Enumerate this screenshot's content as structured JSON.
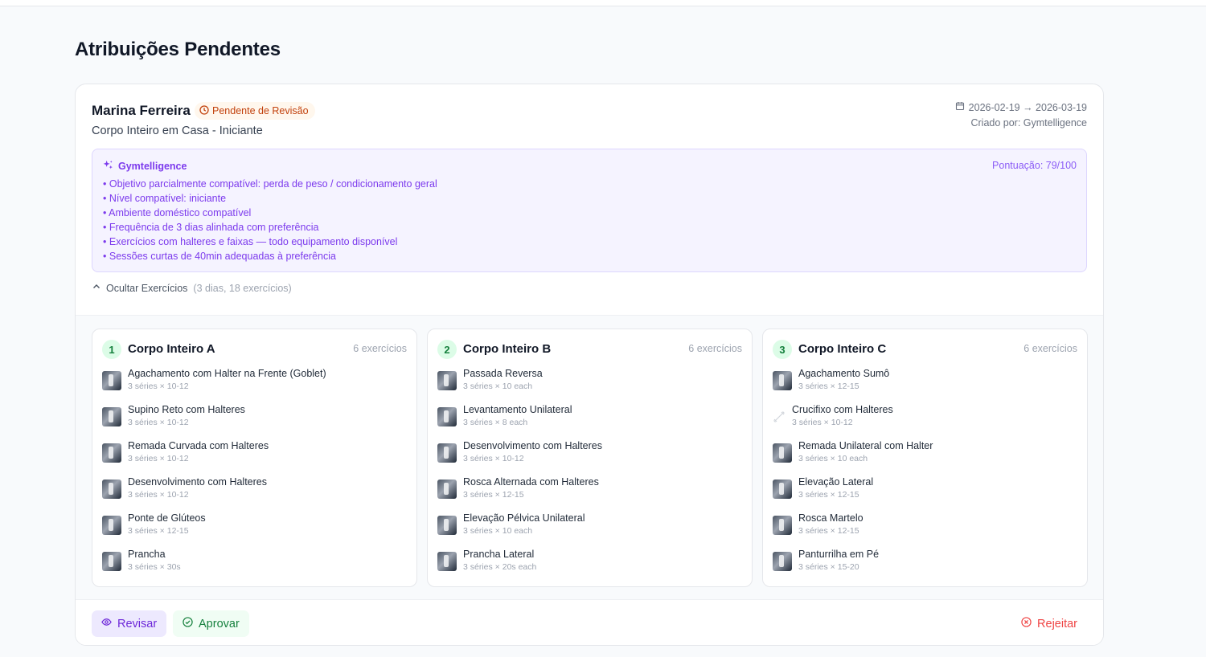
{
  "page": {
    "title": "Atribuições Pendentes"
  },
  "assignment": {
    "client_name": "Marina Ferreira",
    "status": "Pendente de Revisão",
    "plan_name": "Corpo Inteiro em Casa - Iniciante",
    "date_range": "2026-02-19 → 2026-03-19",
    "created_by": "Criado por: Gymtelligence"
  },
  "ai": {
    "label": "Gymtelligence",
    "score": "Pontuação: 79/100",
    "notes": [
      "Objetivo parcialmente compatível: perda de peso / condicionamento geral",
      "Nível compatível: iniciante",
      "Ambiente doméstico compatível",
      "Frequência de 3 dias alinhada com preferência",
      "Exercícios com halteres e faixas — todo equipamento disponível",
      "Sessões curtas de 40min adequadas à preferência"
    ]
  },
  "toggle": {
    "label": "Ocultar Exercícios",
    "summary": "(3 dias, 18 exercícios)"
  },
  "days": [
    {
      "number": "1",
      "title": "Corpo Inteiro A",
      "count": "6 exercícios",
      "exercises": [
        {
          "name": "Agachamento com Halter na Frente (Goblet)",
          "sets": "3 séries × 10-12"
        },
        {
          "name": "Supino Reto com Halteres",
          "sets": "3 séries × 10-12"
        },
        {
          "name": "Remada Curvada com Halteres",
          "sets": "3 séries × 10-12"
        },
        {
          "name": "Desenvolvimento com Halteres",
          "sets": "3 séries × 10-12"
        },
        {
          "name": "Ponte de Glúteos",
          "sets": "3 séries × 12-15"
        },
        {
          "name": "Prancha",
          "sets": "3 séries × 30s"
        }
      ]
    },
    {
      "number": "2",
      "title": "Corpo Inteiro B",
      "count": "6 exercícios",
      "exercises": [
        {
          "name": "Passada Reversa",
          "sets": "3 séries × 10 each"
        },
        {
          "name": "Levantamento Unilateral",
          "sets": "3 séries × 8 each"
        },
        {
          "name": "Desenvolvimento com Halteres",
          "sets": "3 séries × 10-12"
        },
        {
          "name": "Rosca Alternada com Halteres",
          "sets": "3 séries × 12-15"
        },
        {
          "name": "Elevação Pélvica Unilateral",
          "sets": "3 séries × 10 each"
        },
        {
          "name": "Prancha Lateral",
          "sets": "3 séries × 20s each"
        }
      ]
    },
    {
      "number": "3",
      "title": "Corpo Inteiro C",
      "count": "6 exercícios",
      "exercises": [
        {
          "name": "Agachamento Sumô",
          "sets": "3 séries × 12-15"
        },
        {
          "name": "Crucifixo com Halteres",
          "sets": "3 séries × 10-12"
        },
        {
          "name": "Remada Unilateral com Halter",
          "sets": "3 séries × 10 each"
        },
        {
          "name": "Elevação Lateral",
          "sets": "3 séries × 12-15"
        },
        {
          "name": "Rosca Martelo",
          "sets": "3 séries × 12-15"
        },
        {
          "name": "Panturrilha em Pé",
          "sets": "3 séries × 15-20"
        }
      ]
    }
  ],
  "actions": {
    "review": "Revisar",
    "approve": "Aprovar",
    "reject": "Rejeitar"
  },
  "colors": {
    "accent": "#7c3aed",
    "pending": "#c2410c",
    "approve": "#15803d",
    "reject": "#ef4444"
  }
}
